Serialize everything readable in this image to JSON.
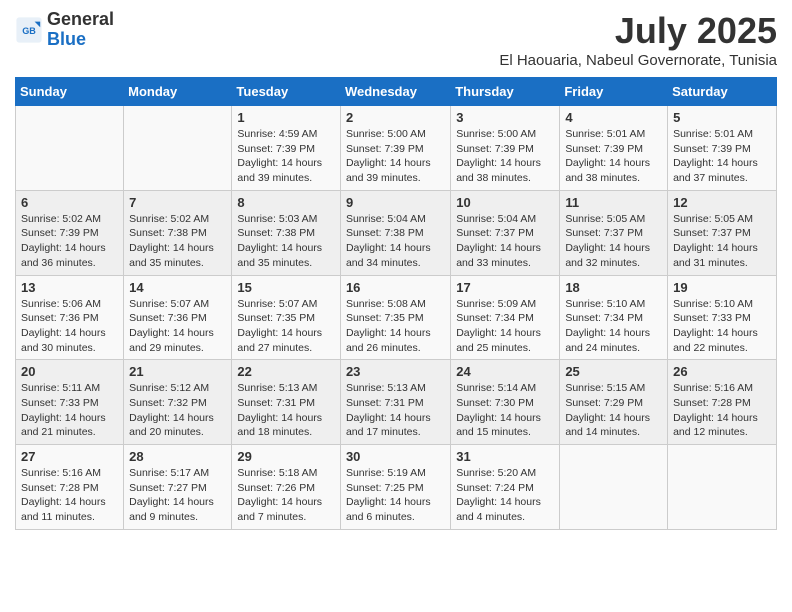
{
  "logo": {
    "text_general": "General",
    "text_blue": "Blue"
  },
  "title": {
    "month_year": "July 2025",
    "location": "El Haouaria, Nabeul Governorate, Tunisia"
  },
  "headers": [
    "Sunday",
    "Monday",
    "Tuesday",
    "Wednesday",
    "Thursday",
    "Friday",
    "Saturday"
  ],
  "weeks": [
    [
      {
        "day": "",
        "sunrise": "",
        "sunset": "",
        "daylight": ""
      },
      {
        "day": "",
        "sunrise": "",
        "sunset": "",
        "daylight": ""
      },
      {
        "day": "1",
        "sunrise": "Sunrise: 4:59 AM",
        "sunset": "Sunset: 7:39 PM",
        "daylight": "Daylight: 14 hours and 39 minutes."
      },
      {
        "day": "2",
        "sunrise": "Sunrise: 5:00 AM",
        "sunset": "Sunset: 7:39 PM",
        "daylight": "Daylight: 14 hours and 39 minutes."
      },
      {
        "day": "3",
        "sunrise": "Sunrise: 5:00 AM",
        "sunset": "Sunset: 7:39 PM",
        "daylight": "Daylight: 14 hours and 38 minutes."
      },
      {
        "day": "4",
        "sunrise": "Sunrise: 5:01 AM",
        "sunset": "Sunset: 7:39 PM",
        "daylight": "Daylight: 14 hours and 38 minutes."
      },
      {
        "day": "5",
        "sunrise": "Sunrise: 5:01 AM",
        "sunset": "Sunset: 7:39 PM",
        "daylight": "Daylight: 14 hours and 37 minutes."
      }
    ],
    [
      {
        "day": "6",
        "sunrise": "Sunrise: 5:02 AM",
        "sunset": "Sunset: 7:39 PM",
        "daylight": "Daylight: 14 hours and 36 minutes."
      },
      {
        "day": "7",
        "sunrise": "Sunrise: 5:02 AM",
        "sunset": "Sunset: 7:38 PM",
        "daylight": "Daylight: 14 hours and 35 minutes."
      },
      {
        "day": "8",
        "sunrise": "Sunrise: 5:03 AM",
        "sunset": "Sunset: 7:38 PM",
        "daylight": "Daylight: 14 hours and 35 minutes."
      },
      {
        "day": "9",
        "sunrise": "Sunrise: 5:04 AM",
        "sunset": "Sunset: 7:38 PM",
        "daylight": "Daylight: 14 hours and 34 minutes."
      },
      {
        "day": "10",
        "sunrise": "Sunrise: 5:04 AM",
        "sunset": "Sunset: 7:37 PM",
        "daylight": "Daylight: 14 hours and 33 minutes."
      },
      {
        "day": "11",
        "sunrise": "Sunrise: 5:05 AM",
        "sunset": "Sunset: 7:37 PM",
        "daylight": "Daylight: 14 hours and 32 minutes."
      },
      {
        "day": "12",
        "sunrise": "Sunrise: 5:05 AM",
        "sunset": "Sunset: 7:37 PM",
        "daylight": "Daylight: 14 hours and 31 minutes."
      }
    ],
    [
      {
        "day": "13",
        "sunrise": "Sunrise: 5:06 AM",
        "sunset": "Sunset: 7:36 PM",
        "daylight": "Daylight: 14 hours and 30 minutes."
      },
      {
        "day": "14",
        "sunrise": "Sunrise: 5:07 AM",
        "sunset": "Sunset: 7:36 PM",
        "daylight": "Daylight: 14 hours and 29 minutes."
      },
      {
        "day": "15",
        "sunrise": "Sunrise: 5:07 AM",
        "sunset": "Sunset: 7:35 PM",
        "daylight": "Daylight: 14 hours and 27 minutes."
      },
      {
        "day": "16",
        "sunrise": "Sunrise: 5:08 AM",
        "sunset": "Sunset: 7:35 PM",
        "daylight": "Daylight: 14 hours and 26 minutes."
      },
      {
        "day": "17",
        "sunrise": "Sunrise: 5:09 AM",
        "sunset": "Sunset: 7:34 PM",
        "daylight": "Daylight: 14 hours and 25 minutes."
      },
      {
        "day": "18",
        "sunrise": "Sunrise: 5:10 AM",
        "sunset": "Sunset: 7:34 PM",
        "daylight": "Daylight: 14 hours and 24 minutes."
      },
      {
        "day": "19",
        "sunrise": "Sunrise: 5:10 AM",
        "sunset": "Sunset: 7:33 PM",
        "daylight": "Daylight: 14 hours and 22 minutes."
      }
    ],
    [
      {
        "day": "20",
        "sunrise": "Sunrise: 5:11 AM",
        "sunset": "Sunset: 7:33 PM",
        "daylight": "Daylight: 14 hours and 21 minutes."
      },
      {
        "day": "21",
        "sunrise": "Sunrise: 5:12 AM",
        "sunset": "Sunset: 7:32 PM",
        "daylight": "Daylight: 14 hours and 20 minutes."
      },
      {
        "day": "22",
        "sunrise": "Sunrise: 5:13 AM",
        "sunset": "Sunset: 7:31 PM",
        "daylight": "Daylight: 14 hours and 18 minutes."
      },
      {
        "day": "23",
        "sunrise": "Sunrise: 5:13 AM",
        "sunset": "Sunset: 7:31 PM",
        "daylight": "Daylight: 14 hours and 17 minutes."
      },
      {
        "day": "24",
        "sunrise": "Sunrise: 5:14 AM",
        "sunset": "Sunset: 7:30 PM",
        "daylight": "Daylight: 14 hours and 15 minutes."
      },
      {
        "day": "25",
        "sunrise": "Sunrise: 5:15 AM",
        "sunset": "Sunset: 7:29 PM",
        "daylight": "Daylight: 14 hours and 14 minutes."
      },
      {
        "day": "26",
        "sunrise": "Sunrise: 5:16 AM",
        "sunset": "Sunset: 7:28 PM",
        "daylight": "Daylight: 14 hours and 12 minutes."
      }
    ],
    [
      {
        "day": "27",
        "sunrise": "Sunrise: 5:16 AM",
        "sunset": "Sunset: 7:28 PM",
        "daylight": "Daylight: 14 hours and 11 minutes."
      },
      {
        "day": "28",
        "sunrise": "Sunrise: 5:17 AM",
        "sunset": "Sunset: 7:27 PM",
        "daylight": "Daylight: 14 hours and 9 minutes."
      },
      {
        "day": "29",
        "sunrise": "Sunrise: 5:18 AM",
        "sunset": "Sunset: 7:26 PM",
        "daylight": "Daylight: 14 hours and 7 minutes."
      },
      {
        "day": "30",
        "sunrise": "Sunrise: 5:19 AM",
        "sunset": "Sunset: 7:25 PM",
        "daylight": "Daylight: 14 hours and 6 minutes."
      },
      {
        "day": "31",
        "sunrise": "Sunrise: 5:20 AM",
        "sunset": "Sunset: 7:24 PM",
        "daylight": "Daylight: 14 hours and 4 minutes."
      },
      {
        "day": "",
        "sunrise": "",
        "sunset": "",
        "daylight": ""
      },
      {
        "day": "",
        "sunrise": "",
        "sunset": "",
        "daylight": ""
      }
    ]
  ]
}
